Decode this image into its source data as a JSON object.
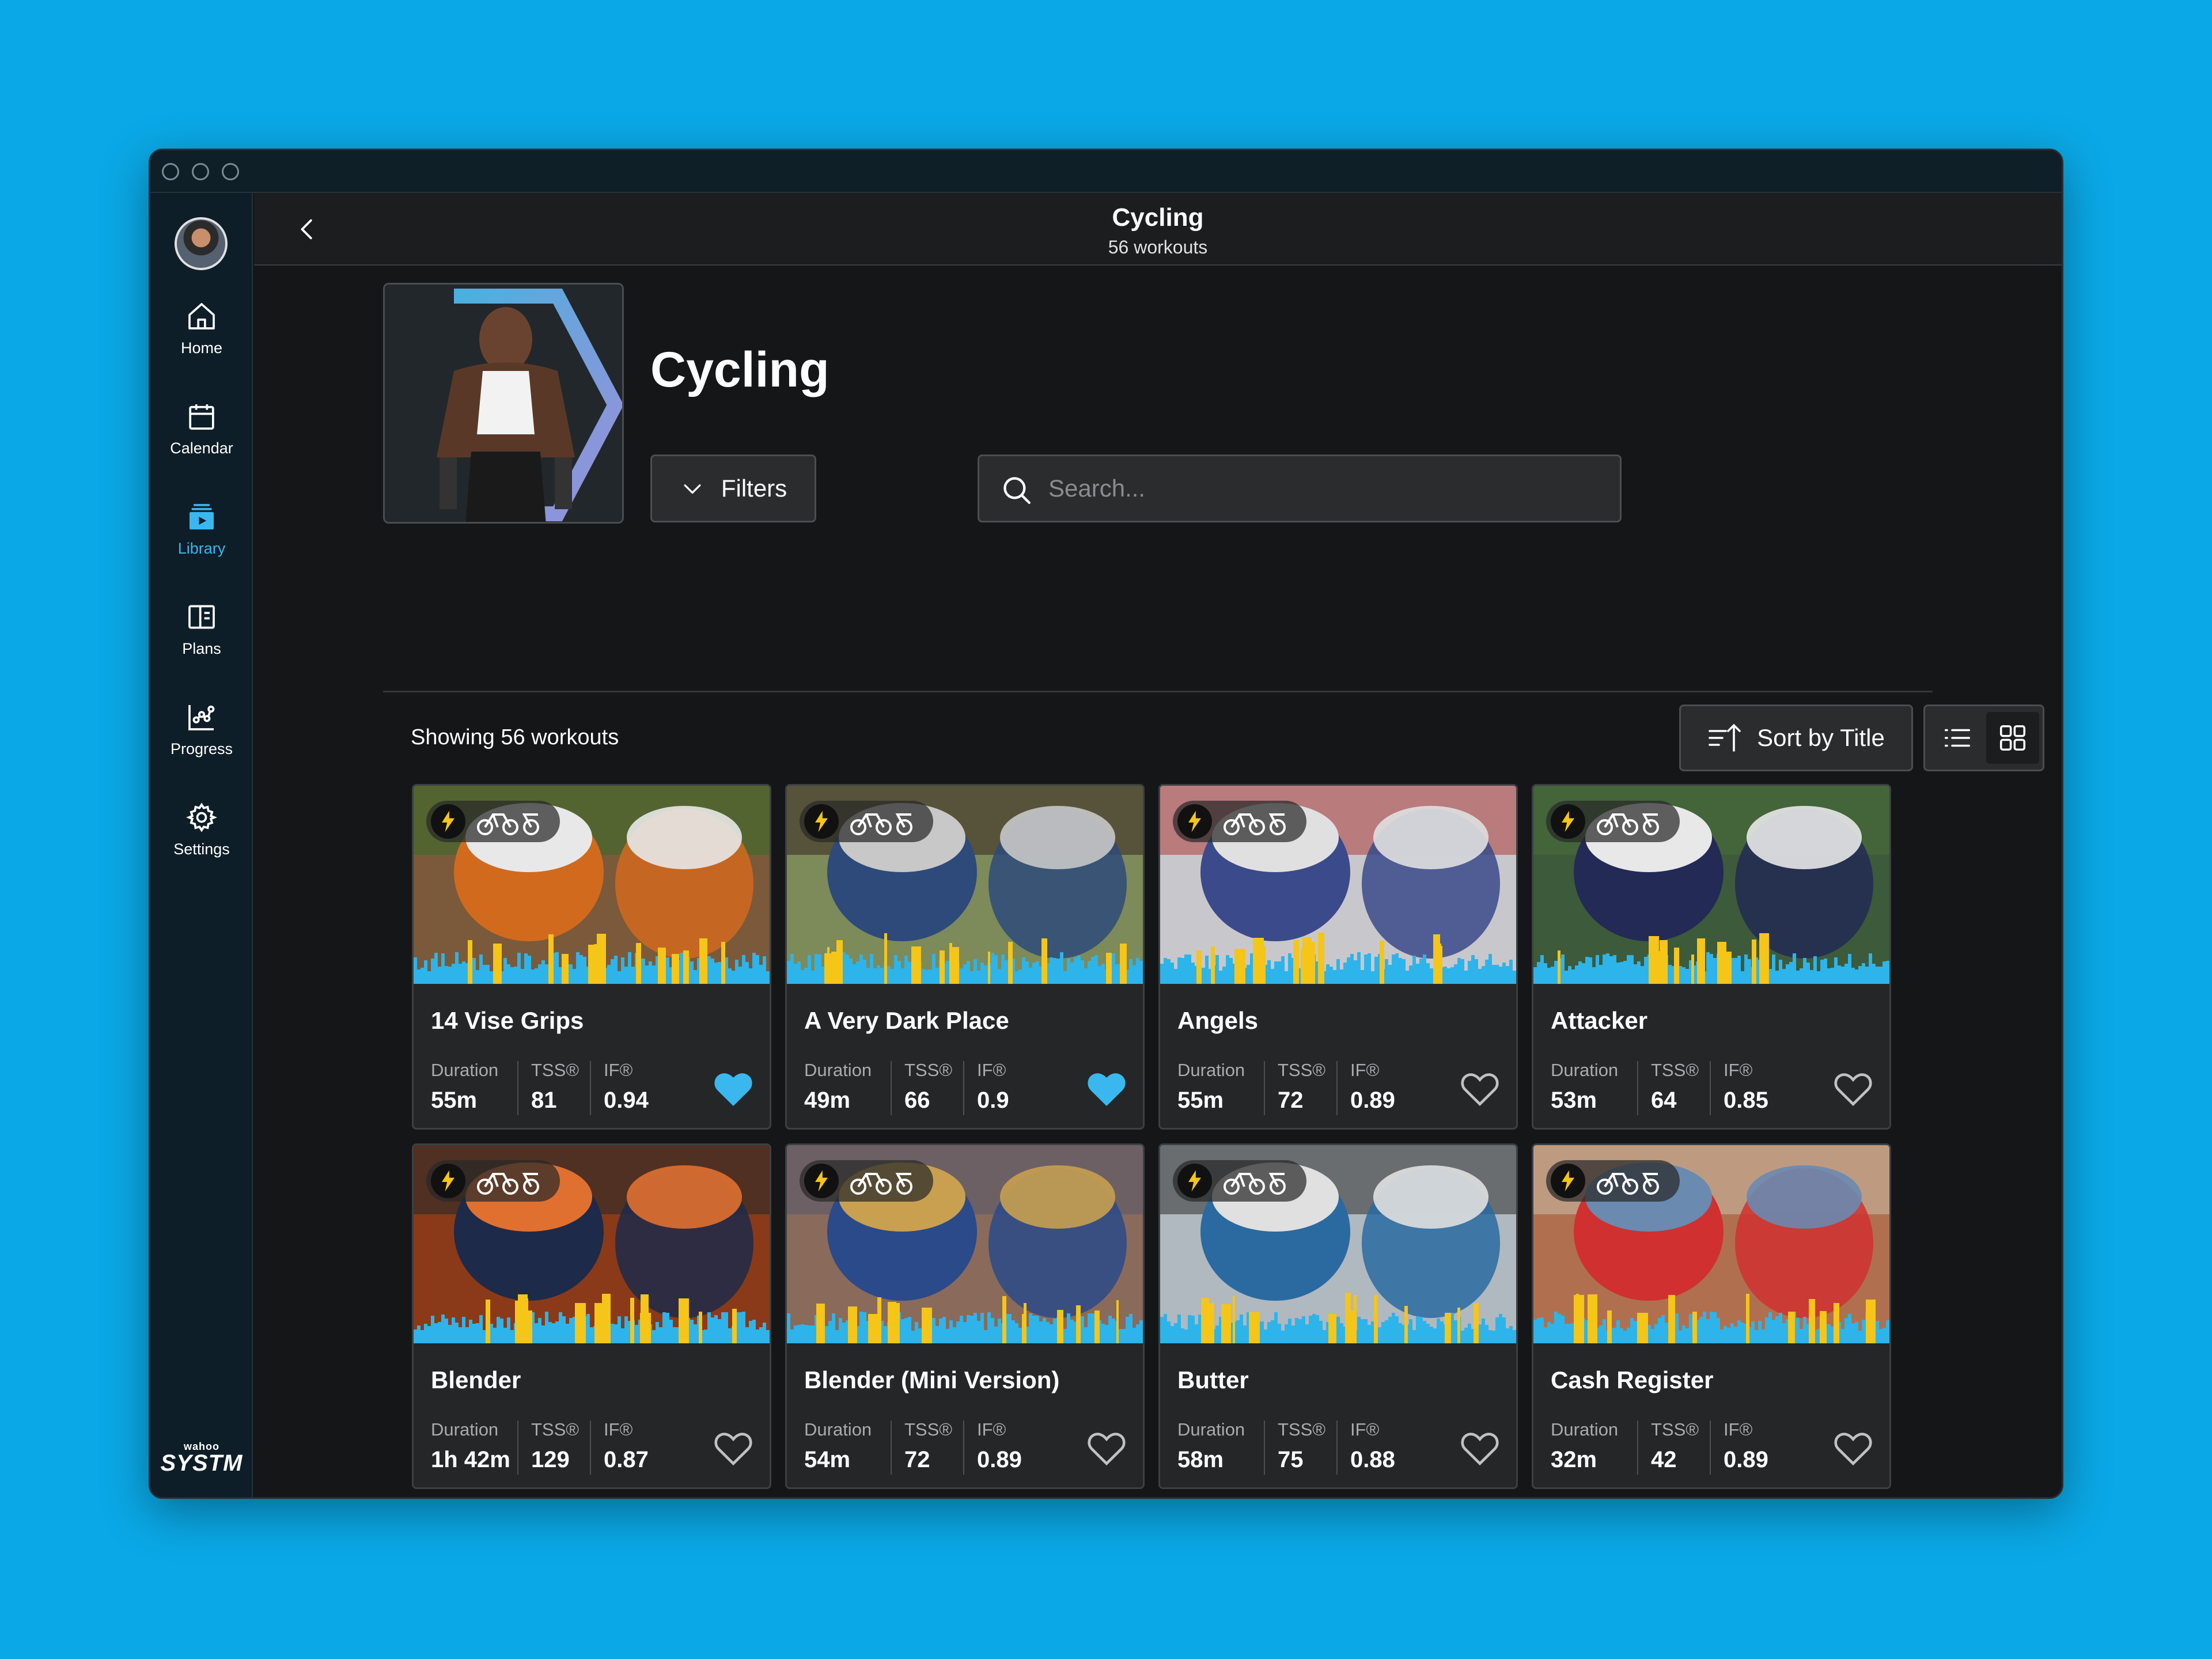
{
  "header": {
    "title": "Cycling",
    "subtitle": "56 workouts"
  },
  "sidebar": {
    "items": [
      {
        "label": "Home",
        "icon": "home-icon",
        "active": false
      },
      {
        "label": "Calendar",
        "icon": "calendar-icon",
        "active": false
      },
      {
        "label": "Library",
        "icon": "library-icon",
        "active": true
      },
      {
        "label": "Plans",
        "icon": "plans-icon",
        "active": false
      },
      {
        "label": "Progress",
        "icon": "progress-icon",
        "active": false
      },
      {
        "label": "Settings",
        "icon": "gear-icon",
        "active": false
      }
    ],
    "brand_small": "wahoo",
    "brand_big": "SYSTM"
  },
  "main": {
    "title": "Cycling",
    "filters_label": "Filters",
    "search_placeholder": "Search...",
    "showing": "Showing 56 workouts",
    "sort_label": "Sort by Title"
  },
  "metric_labels": {
    "duration": "Duration",
    "tss": "TSS®",
    "if": "IF®"
  },
  "workouts": [
    {
      "title": "14 Vise Grips",
      "duration": "55m",
      "tss": "81",
      "if": "0.94",
      "favorite": true
    },
    {
      "title": "A Very Dark Place",
      "duration": "49m",
      "tss": "66",
      "if": "0.9",
      "favorite": true
    },
    {
      "title": "Angels",
      "duration": "55m",
      "tss": "72",
      "if": "0.89",
      "favorite": false
    },
    {
      "title": "Attacker",
      "duration": "53m",
      "tss": "64",
      "if": "0.85",
      "favorite": false
    },
    {
      "title": "Blender",
      "duration": "1h 42m",
      "tss": "129",
      "if": "0.87",
      "favorite": false
    },
    {
      "title": "Blender (Mini Version)",
      "duration": "54m",
      "tss": "72",
      "if": "0.89",
      "favorite": false
    },
    {
      "title": "Butter",
      "duration": "58m",
      "tss": "75",
      "if": "0.88",
      "favorite": false
    },
    {
      "title": "Cash Register",
      "duration": "32m",
      "tss": "42",
      "if": "0.89",
      "favorite": false
    }
  ],
  "colors": {
    "accent": "#3ab7ee",
    "favorite": "#3ab7ee",
    "profile_blue": "#2db4ea",
    "profile_yellow": "#f5c518",
    "background": "#0aa8e6"
  }
}
